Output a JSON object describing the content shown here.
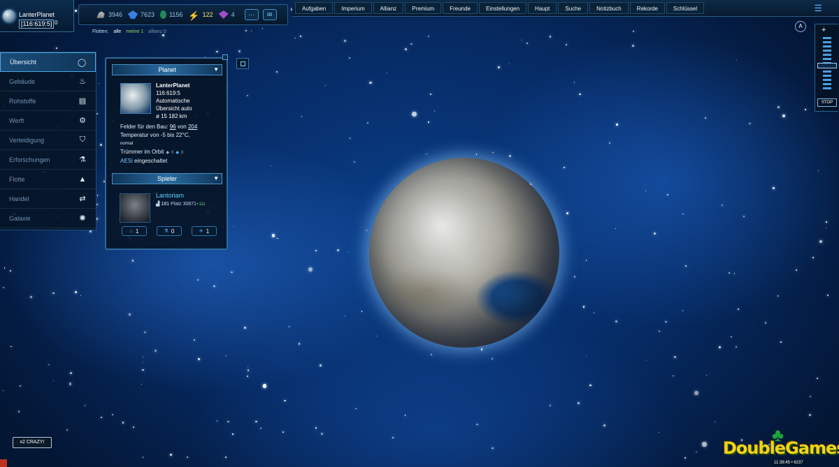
{
  "planet_box": {
    "name": "LanterPlanet",
    "coords": "[116:619:5]",
    "mark": "0"
  },
  "resources": [
    {
      "icon": "metal-icon",
      "value": "3946",
      "highlight": false
    },
    {
      "icon": "crystal-icon",
      "value": "7623",
      "highlight": false
    },
    {
      "icon": "deuterium-icon",
      "value": "1156",
      "highlight": false
    },
    {
      "icon": "energy-icon",
      "value": "122",
      "highlight": true
    },
    {
      "icon": "dark-matter-icon",
      "value": "4",
      "highlight": false
    }
  ],
  "fleets": {
    "label": "Flotten:",
    "all": "alle",
    "own": "meine 1",
    "ally": "allianz 0"
  },
  "nav": [
    "Aufgaben",
    "Imperium",
    "Allianz",
    "Premium",
    "Freunde",
    "Einstellungen",
    "Haupt",
    "Suche",
    "Notizbuch",
    "Rekorde",
    "Schlüssel"
  ],
  "sidebar": [
    {
      "label": "Übersicht",
      "icon": "ring-icon",
      "glyph": "◯",
      "active": true
    },
    {
      "label": "Gebäude",
      "icon": "flame-icon",
      "glyph": "♨",
      "active": false
    },
    {
      "label": "Rohstoffe",
      "icon": "resources-icon",
      "glyph": "▤",
      "active": false
    },
    {
      "label": "Werft",
      "icon": "gear-icon",
      "glyph": "⚙",
      "active": false
    },
    {
      "label": "Verteidigung",
      "icon": "shield-icon",
      "glyph": "⛉",
      "active": false
    },
    {
      "label": "Erforschungen",
      "icon": "microscope-icon",
      "glyph": "⚗",
      "active": false
    },
    {
      "label": "Flotte",
      "icon": "rocket-icon",
      "glyph": "▲",
      "active": false
    },
    {
      "label": "Handel",
      "icon": "exchange-icon",
      "glyph": "⇄",
      "active": false
    },
    {
      "label": "Galaxie",
      "icon": "galaxy-icon",
      "glyph": "✺",
      "active": false
    }
  ],
  "planet_panel": {
    "header": "Planet",
    "name": "LanterPlanet",
    "coords": "116:619:5",
    "type_line1": "Automatische",
    "type_line2": "Übersicht auto",
    "diameter": "ø 15 182 km",
    "fields_label": "Felder für den Bau: ",
    "fields_used": "96",
    "fields_sep": " von ",
    "fields_total": "204",
    "temperature": "Temperatur von -5 bis 22°C,",
    "temp_note": "normal",
    "debris_label": "Trümmer im Orbit",
    "debris_metal": "0",
    "debris_crystal": "0",
    "aes_label": "AESi",
    "aes_status": " eingeschaltet"
  },
  "player_panel": {
    "header": "Spieler",
    "name": "Lantoriam",
    "score": "181",
    "rank": "Platz 30871",
    "rank_change": "+111",
    "badges": [
      {
        "icon": "building-badge-icon",
        "glyph": "⌂",
        "value": "1"
      },
      {
        "icon": "research-badge-icon",
        "glyph": "⚗",
        "value": "0"
      },
      {
        "icon": "fleet-badge-icon",
        "glyph": "✈",
        "value": "1"
      }
    ]
  },
  "zoom": {
    "plus": "+",
    "stop": "STOP",
    "level": 0.45
  },
  "crazy_badge": "x2 CRAZY!",
  "clock": "11:39:45 • 6237",
  "watermark": "DoubleGames",
  "colors": {
    "accent": "#4fb3ff",
    "panel_border": "#2e6a9b",
    "player_name": "#62d0ff",
    "energy": "#ffe36b"
  }
}
